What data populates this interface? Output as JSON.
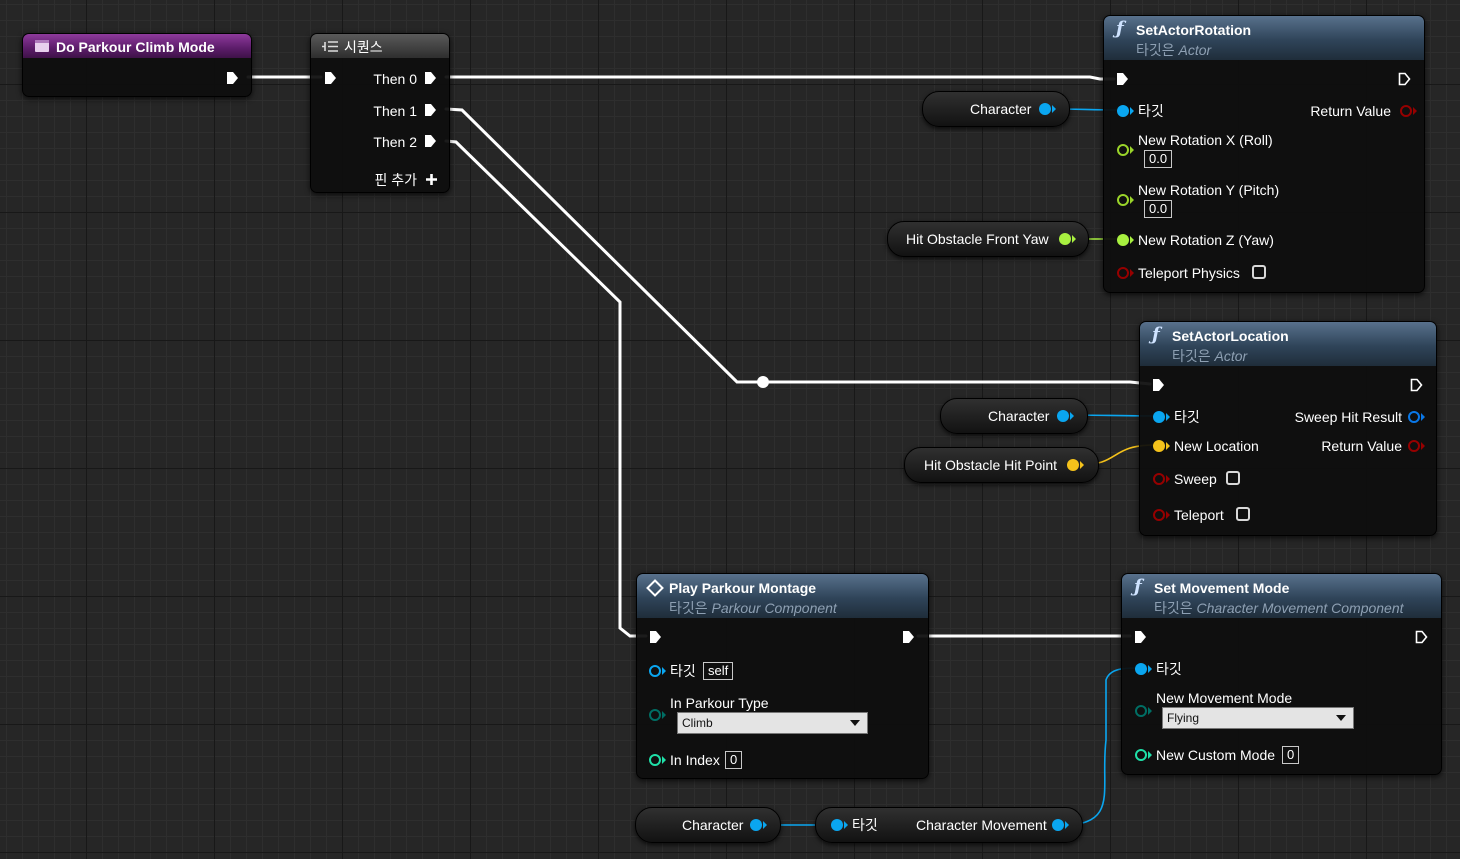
{
  "event_node": {
    "title": "Do Parkour Climb Mode"
  },
  "sequence_node": {
    "title": "시퀀스",
    "outputs": [
      "Then 0",
      "Then 1",
      "Then 2"
    ],
    "add_pin_label": "핀 추가"
  },
  "set_actor_rotation": {
    "title": "SetActorRotation",
    "target_prefix": "타깃은",
    "target_class": "Actor",
    "target_label": "타깃",
    "return_value": "Return Value",
    "roll_label": "New Rotation X (Roll)",
    "roll_value": "0.0",
    "pitch_label": "New Rotation Y (Pitch)",
    "pitch_value": "0.0",
    "yaw_label": "New Rotation Z (Yaw)",
    "teleport_physics_label": "Teleport Physics"
  },
  "set_actor_location": {
    "title": "SetActorLocation",
    "target_prefix": "타깃은",
    "target_class": "Actor",
    "target_label": "타깃",
    "sweep_hit_result": "Sweep Hit Result",
    "new_location_label": "New Location",
    "return_value": "Return Value",
    "sweep_label": "Sweep",
    "teleport_label": "Teleport"
  },
  "play_parkour_montage": {
    "title": "Play Parkour Montage",
    "target_prefix": "타깃은",
    "target_class": "Parkour Component",
    "target_label": "타깃",
    "target_value": "self",
    "parkour_type_label": "In Parkour Type",
    "parkour_type_value": "Climb",
    "index_label": "In Index",
    "index_value": "0"
  },
  "set_movement_mode": {
    "title": "Set Movement Mode",
    "target_prefix": "타깃은",
    "target_class": "Character Movement Component",
    "target_label": "타깃",
    "movement_mode_label": "New Movement Mode",
    "movement_mode_value": "Flying",
    "custom_mode_label": "New Custom Mode",
    "custom_mode_value": "0"
  },
  "getters": {
    "character_1": "Character",
    "hit_obstacle_front_yaw": "Hit Obstacle Front Yaw",
    "character_2": "Character",
    "hit_obstacle_hit_point": "Hit Obstacle Hit Point",
    "character_3": "Character",
    "character_movement_target": "타깃",
    "character_movement": "Character Movement"
  },
  "colors": {
    "exec": "#ffffff",
    "object_pin": "#0aa6f0",
    "rotator_pin": "#9ad42a",
    "float_pin": "#a8f040",
    "vector_pin": "#f5c21b",
    "bool_pin": "#960000",
    "byte_pin": "#006e64",
    "int_pin": "#1fe0a8",
    "event_header": "#7b2b8a",
    "function_header": "#3e5670"
  },
  "icons": {
    "event": "event-icon",
    "sequence": "sequence-icon",
    "function": "function-icon",
    "macro": "diamond-icon"
  }
}
